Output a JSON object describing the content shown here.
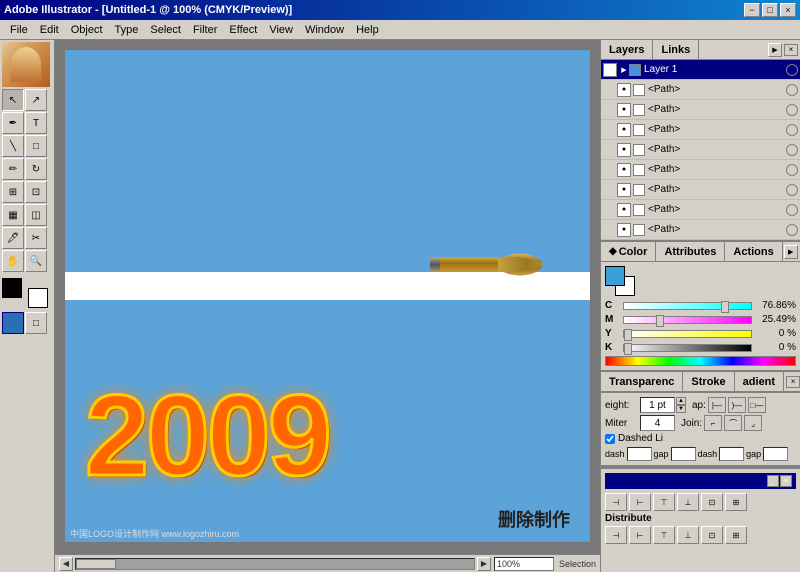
{
  "title_bar": {
    "text": "Adobe Illustrator - [Untitled-1 @ 100% (CMYK/Preview)]",
    "minimize": "−",
    "maximize": "□",
    "close": "×"
  },
  "menu": {
    "items": [
      "File",
      "Edit",
      "Object",
      "Type",
      "Select",
      "Filter",
      "Effect",
      "View",
      "Window",
      "Help"
    ]
  },
  "layers_panel": {
    "tab1": "Layers",
    "tab2": "Links",
    "layer1_name": "Layer 1",
    "paths": [
      "<Path>",
      "<Path>",
      "<Path>",
      "<Path>",
      "<Path>",
      "<Path>",
      "<Path>",
      "<Path>"
    ]
  },
  "color_panel": {
    "tab1": "Color",
    "tab2": "Attributes",
    "tab3": "Actions",
    "c_label": "C",
    "m_label": "M",
    "y_label": "Y",
    "k_label": "K",
    "c_value": "76.86%",
    "m_value": "25.49%",
    "y_value": "0 %",
    "k_value": "0 %"
  },
  "stroke_panel": {
    "tab1": "Transparenc",
    "tab2": "Stroke",
    "tab3": "adient",
    "weight_label": "eight:",
    "miter_label": "Miter",
    "cap_label": "ap:",
    "join_label": "Join:",
    "dashed_label": "Dashed Li",
    "dash_label": "dash",
    "gap_label": "gap"
  },
  "distribute": {
    "label": "Distribute"
  },
  "canvas": {
    "text_2009": "2009",
    "chinese_text": "删除制作",
    "watermark": "中国LOGO设计制作网 www.logozhiru.com"
  },
  "status_bar": {
    "zoom": "100%",
    "selection": "Selection"
  },
  "colors": {
    "canvas_bg": "#5ba3d9",
    "toolbar_bg": "#d4d0c8",
    "text_color": "#ff6600",
    "text_outline": "#ffcc00",
    "panel_active": "#000080"
  }
}
